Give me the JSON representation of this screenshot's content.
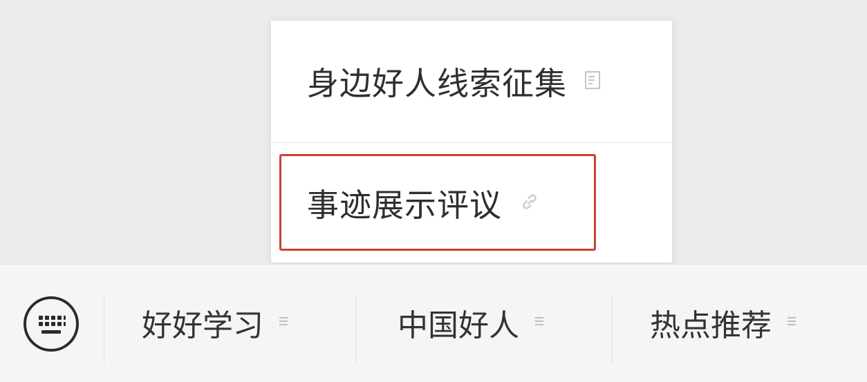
{
  "submenu": {
    "items": [
      {
        "label": "身边好人线索征集",
        "icon": "document-icon"
      },
      {
        "label": "事迹展示评议",
        "icon": "link-icon"
      }
    ],
    "highlighted_index": 1,
    "highlight_color": "#c94038"
  },
  "menu_bar": {
    "keyboard_icon": "keyboard-icon",
    "items": [
      {
        "label": "好好学习",
        "icon": "menu-lines-icon"
      },
      {
        "label": "中国好人",
        "icon": "menu-lines-icon"
      },
      {
        "label": "热点推荐",
        "icon": "menu-lines-icon"
      }
    ]
  },
  "colors": {
    "background": "#ebebeb",
    "popup": "#ffffff",
    "bar": "#f5f5f5",
    "text": "#2e2e2e"
  }
}
